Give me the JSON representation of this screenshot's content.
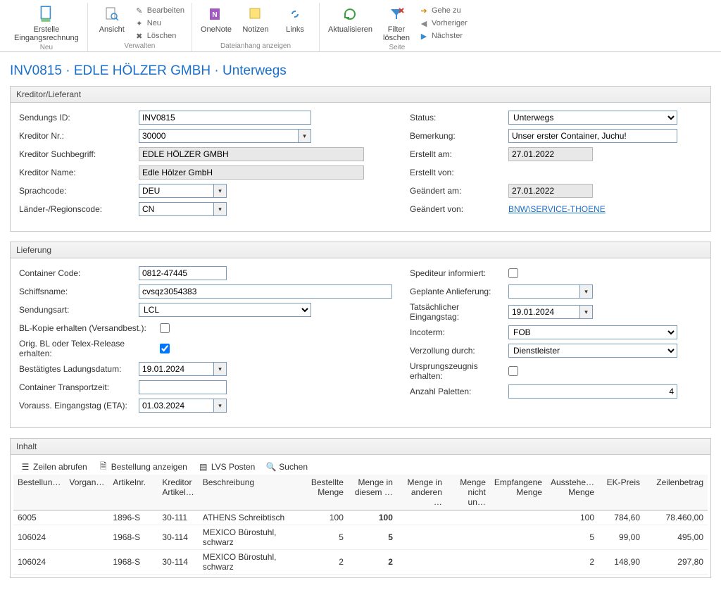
{
  "ribbon": {
    "erstelle_label": "Erstelle\nEingangsrechnung",
    "neu_group": "Neu",
    "ansicht": "Ansicht",
    "bearbeiten": "Bearbeiten",
    "neu_small": "Neu",
    "loeschen": "Löschen",
    "verwalten": "Verwalten",
    "onenote": "OneNote",
    "notizen": "Notizen",
    "links": "Links",
    "dateianhang": "Dateianhang anzeigen",
    "aktualisieren": "Aktualisieren",
    "filter_loeschen": "Filter\nlöschen",
    "gehe_zu": "Gehe zu",
    "vorheriger": "Vorheriger",
    "naechster": "Nächster",
    "seite": "Seite"
  },
  "title": "INV0815 · EDLE HÖLZER GMBH · Unterwegs",
  "kreditor": {
    "heading": "Kreditor/Lieferant",
    "sendungs_id_label": "Sendungs ID:",
    "sendungs_id": "INV0815",
    "kreditor_nr_label": "Kreditor Nr.:",
    "kreditor_nr": "30000",
    "suchbegriff_label": "Kreditor Suchbegriff:",
    "suchbegriff": "EDLE HÖLZER GMBH",
    "name_label": "Kreditor Name:",
    "name": "Edle Hölzer GmbH",
    "sprach_label": "Sprachcode:",
    "sprach": "DEU",
    "region_label": "Länder-/Regionscode:",
    "region": "CN",
    "status_label": "Status:",
    "status": "Unterwegs",
    "bemerkung_label": "Bemerkung:",
    "bemerkung": "Unser erster Container, Juchu!",
    "erstellt_am_label": "Erstellt am:",
    "erstellt_am": "27.01.2022",
    "erstellt_von_label": "Erstellt von:",
    "geaendert_am_label": "Geändert am:",
    "geaendert_am": "27.01.2022",
    "geaendert_von_label": "Geändert von:",
    "geaendert_von": "BNW\\SERVICE-THOENE"
  },
  "lieferung": {
    "heading": "Lieferung",
    "container_code_label": "Container Code:",
    "container_code": "0812-47445",
    "schiff_label": "Schiffsname:",
    "schiff": "cvsqz3054383",
    "sendungsart_label": "Sendungsart:",
    "sendungsart": "LCL",
    "bl_kopie_label": "BL-Kopie erhalten (Versandbest.):",
    "orig_bl_label": "Orig. BL oder Telex-Release erhalten:",
    "ladungsdatum_label": "Bestätigtes Ladungsdatum:",
    "ladungsdatum": "19.01.2024",
    "transportzeit_label": "Container Transportzeit:",
    "transportzeit": "",
    "eta_label": "Vorauss. Eingangstag (ETA):",
    "eta": "01.03.2024",
    "spediteur_label": "Spediteur informiert:",
    "geplante_label": "Geplante Anlieferung:",
    "geplante": "",
    "tatsaechlicher_label": "Tatsächlicher Eingangstag:",
    "tatsaechlicher": "19.01.2024",
    "incoterm_label": "Incoterm:",
    "incoterm": "FOB",
    "verzollung_label": "Verzollung durch:",
    "verzollung": "Dienstleister",
    "ursprung_label": "Ursprungszeugnis erhalten:",
    "paletten_label": "Anzahl Paletten:",
    "paletten": "4"
  },
  "inhalt": {
    "heading": "Inhalt",
    "btn_zeilen": "Zeilen abrufen",
    "btn_bestellung": "Bestellung anzeigen",
    "btn_lvs": "LVS Posten",
    "btn_suchen": "Suchen",
    "cols": {
      "bestell": "Bestellun…",
      "vorgan": "Vorgan…",
      "artikelnr": "Artikelnr.",
      "kart": "Kreditor Artikel…",
      "beschr": "Beschreibung",
      "bestmenge": "Bestellte Menge",
      "diesem": "Menge in diesem …",
      "anderen": "Menge in anderen …",
      "nicht": "Menge nicht un…",
      "empf": "Empfangene Menge",
      "ausst": "Ausstehe… Menge",
      "ek": "EK-Preis",
      "zeile": "Zeilenbetrag"
    },
    "rows": [
      {
        "bestell": "6005",
        "vorgan": "",
        "artikelnr": "1896-S",
        "kart": "30-111",
        "beschr": "ATHENS Schreibtisch",
        "bestmenge": "100",
        "diesem": "100",
        "anderen": "",
        "nicht": "",
        "empf": "",
        "ausst": "100",
        "ek": "784,60",
        "zeile": "78.460,00"
      },
      {
        "bestell": "106024",
        "vorgan": "",
        "artikelnr": "1968-S",
        "kart": "30-114",
        "beschr": "MEXICO Bürostuhl, schwarz",
        "bestmenge": "5",
        "diesem": "5",
        "anderen": "",
        "nicht": "",
        "empf": "",
        "ausst": "5",
        "ek": "99,00",
        "zeile": "495,00"
      },
      {
        "bestell": "106024",
        "vorgan": "",
        "artikelnr": "1968-S",
        "kart": "30-114",
        "beschr": "MEXICO Bürostuhl, schwarz",
        "bestmenge": "2",
        "diesem": "2",
        "anderen": "",
        "nicht": "",
        "empf": "",
        "ausst": "2",
        "ek": "148,90",
        "zeile": "297,80"
      }
    ]
  }
}
